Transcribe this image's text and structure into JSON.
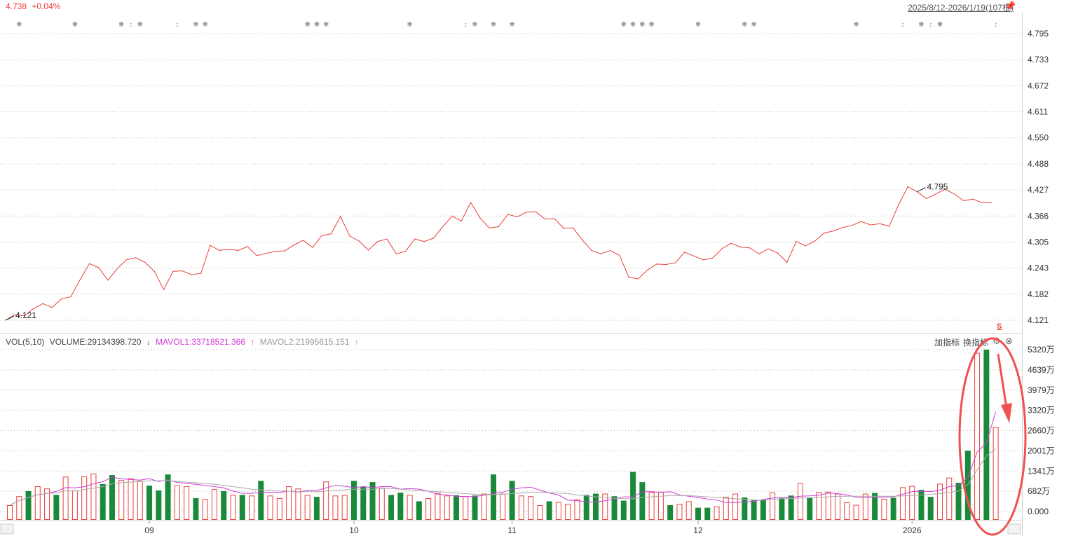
{
  "header": {
    "last_price": "4.738",
    "change_pct": "+0.04%",
    "range_text": "2025/8/12-2026/1/19(107根)",
    "pin_icon": "pin-icon"
  },
  "indicator": {
    "vol_label": "VOL(5,10)",
    "volume_label": "VOLUME:29134398.720",
    "volume_arrow": "↓",
    "mavol1_label": "MAVOL1:33718521.366",
    "mavol1_arrow": "↑",
    "mavol2_label": "MAVOL2:21995615.151",
    "mavol2_arrow": "↑",
    "add_indicator": "加指标",
    "switch_indicator": "换指标",
    "gear_icon": "gear-icon",
    "close_icon": "close-circle-icon",
    "signal_mark": "S"
  },
  "colors": {
    "up": "#e8413a",
    "down": "#1a8a3a",
    "price_line": "#e8413a",
    "mavol1": "#d23ad6",
    "mavol2": "#aaaaaa",
    "annotation": "#f05050"
  },
  "chart_data": [
    {
      "type": "line",
      "name": "price",
      "y_ticks": [
        "4.795",
        "4.733",
        "4.672",
        "4.611",
        "4.550",
        "4.488",
        "4.427",
        "4.366",
        "4.305",
        "4.243",
        "4.182",
        "4.121"
      ],
      "ylim": [
        4.121,
        4.795
      ],
      "values": [
        4.121,
        4.134,
        4.131,
        4.148,
        4.16,
        4.151,
        4.171,
        4.176,
        4.216,
        4.254,
        4.245,
        4.215,
        4.242,
        4.263,
        4.268,
        4.257,
        4.236,
        4.193,
        4.236,
        4.237,
        4.228,
        4.231,
        4.297,
        4.285,
        4.288,
        4.285,
        4.294,
        4.273,
        4.278,
        4.283,
        4.284,
        4.298,
        4.309,
        4.292,
        4.32,
        4.324,
        4.365,
        4.319,
        4.307,
        4.286,
        4.306,
        4.312,
        4.277,
        4.283,
        4.312,
        4.306,
        4.314,
        4.341,
        4.366,
        4.354,
        4.398,
        4.362,
        4.338,
        4.341,
        4.37,
        4.364,
        4.375,
        4.376,
        4.359,
        4.36,
        4.337,
        4.338,
        4.31,
        4.285,
        4.277,
        4.285,
        4.274,
        4.222,
        4.218,
        4.239,
        4.253,
        4.252,
        4.256,
        4.281,
        4.272,
        4.263,
        4.267,
        4.289,
        4.302,
        4.293,
        4.291,
        4.277,
        4.289,
        4.279,
        4.257,
        4.306,
        4.296,
        4.307,
        4.326,
        4.331,
        4.339,
        4.344,
        4.353,
        4.345,
        4.348,
        4.342,
        4.392,
        4.435,
        4.423,
        4.407,
        4.418,
        4.429,
        4.418,
        4.402,
        4.406,
        4.397,
        4.398
      ],
      "labels": [
        {
          "text": "4.121",
          "index": 0
        },
        {
          "text": "4.795",
          "index": 98
        }
      ]
    },
    {
      "type": "bar",
      "name": "volume",
      "y_ticks": [
        "5320万",
        "4639万",
        "3979万",
        "3320万",
        "2660万",
        "2001万",
        "1341万",
        "682万",
        "0.000"
      ],
      "ylim": [
        0,
        5320
      ],
      "unit": "万",
      "x_ticks": [
        {
          "label": "09",
          "index": 15
        },
        {
          "label": "10",
          "index": 37
        },
        {
          "label": "11",
          "index": 54
        },
        {
          "label": "12",
          "index": 74
        },
        {
          "label": "2026",
          "index": 97
        }
      ],
      "values": [
        460,
        740,
        900,
        1050,
        980,
        780,
        1350,
        920,
        1360,
        1450,
        1120,
        1400,
        1240,
        1300,
        1220,
        1070,
        920,
        1420,
        1080,
        1050,
        680,
        650,
        960,
        900,
        780,
        780,
        760,
        1220,
        760,
        680,
        1050,
        980,
        780,
        720,
        1200,
        760,
        780,
        1220,
        1040,
        1180,
        1000,
        780,
        850,
        780,
        580,
        680,
        840,
        760,
        770,
        740,
        760,
        820,
        1420,
        820,
        1220,
        760,
        740,
        460,
        580,
        560,
        500,
        640,
        780,
        820,
        820,
        740,
        600,
        1500,
        1180,
        860,
        880,
        460,
        500,
        580,
        380,
        380,
        420,
        720,
        820,
        700,
        620,
        620,
        860,
        680,
        760,
        1140,
        700,
        870,
        880,
        820,
        550,
        470,
        820,
        840,
        660,
        690,
        1020,
        1060,
        940,
        720,
        1130,
        1320,
        1160,
        2160,
        5220,
        5320,
        2900
      ],
      "up_down": [
        1,
        1,
        0,
        1,
        1,
        0,
        1,
        1,
        1,
        1,
        0,
        0,
        1,
        1,
        1,
        0,
        0,
        0,
        1,
        1,
        0,
        1,
        1,
        0,
        1,
        0,
        1,
        0,
        1,
        1,
        1,
        1,
        1,
        0,
        1,
        1,
        1,
        0,
        0,
        0,
        1,
        0,
        0,
        1,
        0,
        1,
        1,
        1,
        0,
        1,
        0,
        1,
        0,
        1,
        0,
        1,
        1,
        1,
        0,
        1,
        1,
        1,
        0,
        0,
        1,
        0,
        0,
        0,
        0,
        1,
        1,
        0,
        1,
        1,
        0,
        0,
        1,
        1,
        1,
        0,
        0,
        0,
        1,
        0,
        0,
        1,
        0,
        1,
        1,
        1,
        1,
        1,
        1,
        0,
        1,
        0,
        1,
        1,
        0,
        0,
        1,
        1,
        0,
        0,
        1,
        0,
        1
      ],
      "series": [
        {
          "name": "MAVOL1",
          "values": [
            460,
            600,
            700,
            787,
            826,
            890,
            1010,
            1000,
            1038,
            1128,
            1196,
            1336,
            1282,
            1262,
            1244,
            1290,
            1200,
            1250,
            1170,
            1140,
            1110,
            1080,
            1040,
            1000,
            900,
            830,
            830,
            870,
            860,
            860,
            900,
            870,
            920,
            920,
            1000,
            1080,
            1050,
            1010,
            1040,
            1010,
            1040,
            1040,
            960,
            980,
            960,
            900,
            800,
            780,
            740,
            730,
            730,
            770,
            820,
            870,
            960,
            1000,
            1020,
            930,
            840,
            780,
            620,
            600,
            560,
            560,
            600,
            650,
            720,
            720,
            880,
            880,
            860,
            880,
            780,
            740,
            700,
            650,
            620,
            540,
            540,
            560,
            580,
            640,
            680,
            700,
            700,
            740,
            750,
            770,
            840,
            820,
            780,
            710,
            700,
            700,
            720,
            720,
            800,
            880,
            900,
            880,
            930,
            1040,
            1080,
            1320,
            2120,
            2400,
            3380
          ]
        },
        {
          "name": "MAVOL2",
          "values": [
            460,
            600,
            700,
            787,
            826,
            840,
            910,
            900,
            950,
            990,
            1040,
            1120,
            1160,
            1180,
            1200,
            1220,
            1220,
            1230,
            1200,
            1180,
            1160,
            1140,
            1110,
            1080,
            1040,
            1000,
            960,
            940,
            920,
            900,
            900,
            880,
            880,
            880,
            900,
            920,
            940,
            960,
            960,
            960,
            980,
            980,
            960,
            940,
            920,
            900,
            880,
            860,
            840,
            820,
            800,
            780,
            790,
            800,
            820,
            840,
            860,
            860,
            850,
            840,
            820,
            780,
            750,
            720,
            700,
            680,
            660,
            660,
            700,
            720,
            740,
            760,
            760,
            760,
            740,
            720,
            700,
            680,
            660,
            640,
            620,
            620,
            640,
            660,
            670,
            680,
            690,
            700,
            720,
            740,
            740,
            740,
            740,
            740,
            740,
            740,
            750,
            760,
            780,
            800,
            820,
            860,
            900,
            1100,
            1560,
            2000,
            2220
          ]
        }
      ]
    }
  ],
  "event_markers": [
    "✱",
    "✱",
    "✱",
    "↕",
    "✱",
    "↕",
    "✱",
    "✱",
    "✱",
    "✱",
    "✱",
    "✱",
    "↕",
    "✱",
    "✱",
    "✱",
    "✱",
    "✱",
    "✱",
    "✱",
    "✱",
    "✱",
    "✱",
    "✱",
    "↕",
    "✱",
    "↕",
    "✱",
    "↕"
  ]
}
